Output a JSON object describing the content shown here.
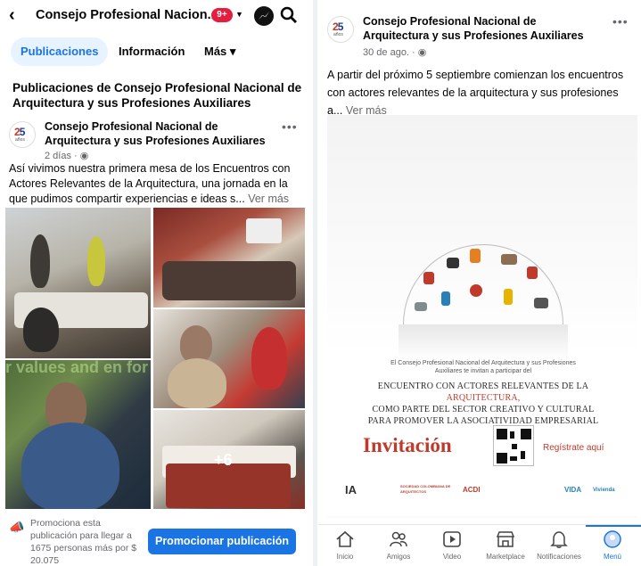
{
  "left": {
    "header": {
      "back_icon": "chevron-left-icon",
      "title": "Consejo Profesional Nacion...",
      "badge": "9+",
      "messenger_icon": "messenger-icon",
      "search_icon": "search-icon"
    },
    "tabs": [
      {
        "label": "Publicaciones",
        "active": true
      },
      {
        "label": "Información",
        "active": false
      },
      {
        "label": "Más ▾",
        "active": false
      }
    ],
    "section_title": "Publicaciones de Consejo Profesional Nacional de Arquitectura y sus Profesiones Auxiliares",
    "post": {
      "author": "Consejo Profesional Nacional de Arquitectura y sus Profesiones Auxiliares",
      "time": "2 días · ",
      "text": "Así vivimos nuestra primera mesa de los Encuentros con Actores Relevantes de la Arquitectura, una jornada en la que pudimos compartir experiencias e ideas s... ",
      "see_more": "Ver más",
      "more_photos": "+6",
      "photo_overlay_text": "r values and en for re... ive sha"
    },
    "promo": {
      "text": "Promociona esta publicación para llegar a 1675 personas más por $ 20.075",
      "button": "Promocionar publicación"
    }
  },
  "right": {
    "post": {
      "author": "Consejo Profesional Nacional de Arquitectura y sus Profesiones Auxiliares",
      "time": "30 de ago. · ",
      "text": "A partir del próximo 5 septiembre comienzan los encuentros con actores relevantes de la arquitectura y sus profesiones a... ",
      "see_more": "Ver más"
    },
    "invitation": {
      "small_text": "El Consejo Profesional Nacional del Arquitectura y sus Profesiones Auxiliares te invitan a participar del",
      "title_line1": "ENCUENTRO CON ACTORES RELEVANTES DE LA ",
      "title_highlight": "ARQUITECTURA,",
      "title_line2": "COMO PARTE DEL SECTOR CREATIVO Y CULTURAL",
      "title_line3": "PARA PROMOVER LA ASOCIATIVIDAD EMPRESARIAL",
      "invitacion": "Invitación",
      "register": "Regístrate aquí",
      "logos": [
        "IA",
        "SOCIEDAD COLOMBIANA DE ARQUITECTOS",
        "ACDI",
        "VIDA",
        "Vivienda"
      ]
    },
    "nav": [
      {
        "label": "Inicio",
        "icon": "home-icon"
      },
      {
        "label": "Amigos",
        "icon": "friends-icon"
      },
      {
        "label": "Video",
        "icon": "video-icon"
      },
      {
        "label": "Marketplace",
        "icon": "marketplace-icon"
      },
      {
        "label": "Notificaciones",
        "icon": "bell-icon"
      },
      {
        "label": "Menú",
        "icon": "menu-avatar-icon",
        "active": true
      }
    ]
  },
  "colors": {
    "accent": "#1b74e4",
    "badge": "#e41e3f",
    "invite_red": "#c0392b"
  }
}
